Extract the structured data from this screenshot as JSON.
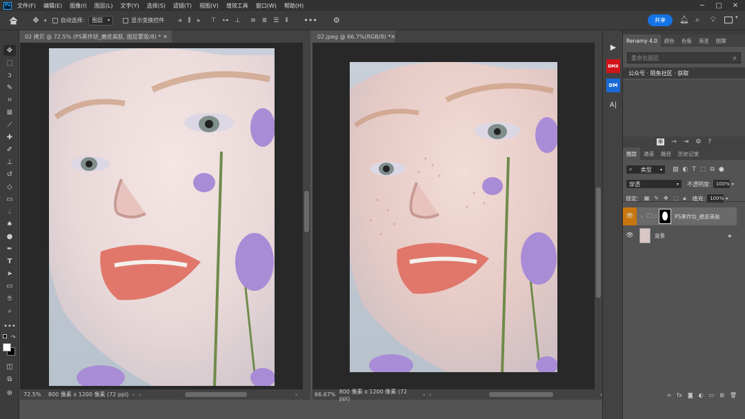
{
  "menu": {
    "logo": "Ps",
    "items": [
      "文件(F)",
      "编辑(E)",
      "图像(I)",
      "图层(L)",
      "文字(Y)",
      "选择(S)",
      "滤镜(T)",
      "视图(V)",
      "增效工具",
      "窗口(W)",
      "帮助(H)"
    ]
  },
  "options": {
    "auto_select_label": "自动选择:",
    "auto_select_value": "图层",
    "show_transform_label": "显示变换控件",
    "share_label": "共享"
  },
  "doc_left": {
    "tab_title": "02 拷贝 @ 72.5% (PS黑作坊_磨皮美肤, 图层蒙版/8) *",
    "zoom": "72.5%",
    "info": "800 像素 x 1200 像素 (72 ppi)"
  },
  "doc_right": {
    "tab_title": "02.jpeg @ 66.7%(RGB/8) *",
    "zoom": "66.67%",
    "info": "800 像素 x 1200 像素 (72 ppi)"
  },
  "renamy": {
    "tabs": [
      "Renamy 4.0",
      "颜色",
      "色板",
      "渐变",
      "图案"
    ],
    "search_placeholder": "重命名图层",
    "promo": "公众号 · 陌鱼社区 · 获取"
  },
  "layers_panel": {
    "tabs": [
      "图层",
      "通道",
      "路径",
      "历史记录"
    ],
    "filter_label": "类型",
    "blend_mode": "穿透",
    "opacity_label": "不透明度:",
    "opacity_value": "100%",
    "lock_label": "锁定:",
    "fill_label": "填充:",
    "fill_value": "100%",
    "layers": [
      {
        "name": "PS黑作坊_磨皮美肤",
        "kind": "group",
        "selected": true
      },
      {
        "name": "背景",
        "kind": "background",
        "selected": false
      }
    ]
  },
  "right_strip": {
    "dmx_label": "DMX",
    "dm_label": "DM",
    "ai_label": "A|"
  },
  "colors": {
    "accent": "#1473e6",
    "selected_layer": "#6a6a6a",
    "eye_selected_bg": "#c7750f"
  }
}
